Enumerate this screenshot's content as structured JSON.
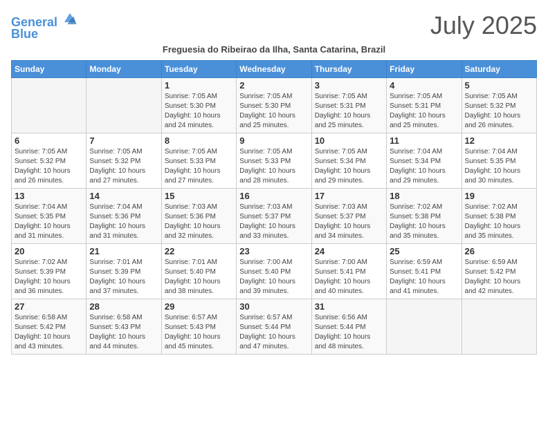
{
  "header": {
    "logo_line1": "General",
    "logo_line2": "Blue",
    "month_title": "July 2025",
    "subtitle": "Freguesia do Ribeirao da Ilha, Santa Catarina, Brazil"
  },
  "weekdays": [
    "Sunday",
    "Monday",
    "Tuesday",
    "Wednesday",
    "Thursday",
    "Friday",
    "Saturday"
  ],
  "weeks": [
    [
      {
        "day": "",
        "detail": ""
      },
      {
        "day": "",
        "detail": ""
      },
      {
        "day": "1",
        "detail": "Sunrise: 7:05 AM\nSunset: 5:30 PM\nDaylight: 10 hours and 24 minutes."
      },
      {
        "day": "2",
        "detail": "Sunrise: 7:05 AM\nSunset: 5:30 PM\nDaylight: 10 hours and 25 minutes."
      },
      {
        "day": "3",
        "detail": "Sunrise: 7:05 AM\nSunset: 5:31 PM\nDaylight: 10 hours and 25 minutes."
      },
      {
        "day": "4",
        "detail": "Sunrise: 7:05 AM\nSunset: 5:31 PM\nDaylight: 10 hours and 25 minutes."
      },
      {
        "day": "5",
        "detail": "Sunrise: 7:05 AM\nSunset: 5:32 PM\nDaylight: 10 hours and 26 minutes."
      }
    ],
    [
      {
        "day": "6",
        "detail": "Sunrise: 7:05 AM\nSunset: 5:32 PM\nDaylight: 10 hours and 26 minutes."
      },
      {
        "day": "7",
        "detail": "Sunrise: 7:05 AM\nSunset: 5:32 PM\nDaylight: 10 hours and 27 minutes."
      },
      {
        "day": "8",
        "detail": "Sunrise: 7:05 AM\nSunset: 5:33 PM\nDaylight: 10 hours and 27 minutes."
      },
      {
        "day": "9",
        "detail": "Sunrise: 7:05 AM\nSunset: 5:33 PM\nDaylight: 10 hours and 28 minutes."
      },
      {
        "day": "10",
        "detail": "Sunrise: 7:05 AM\nSunset: 5:34 PM\nDaylight: 10 hours and 29 minutes."
      },
      {
        "day": "11",
        "detail": "Sunrise: 7:04 AM\nSunset: 5:34 PM\nDaylight: 10 hours and 29 minutes."
      },
      {
        "day": "12",
        "detail": "Sunrise: 7:04 AM\nSunset: 5:35 PM\nDaylight: 10 hours and 30 minutes."
      }
    ],
    [
      {
        "day": "13",
        "detail": "Sunrise: 7:04 AM\nSunset: 5:35 PM\nDaylight: 10 hours and 31 minutes."
      },
      {
        "day": "14",
        "detail": "Sunrise: 7:04 AM\nSunset: 5:36 PM\nDaylight: 10 hours and 31 minutes."
      },
      {
        "day": "15",
        "detail": "Sunrise: 7:03 AM\nSunset: 5:36 PM\nDaylight: 10 hours and 32 minutes."
      },
      {
        "day": "16",
        "detail": "Sunrise: 7:03 AM\nSunset: 5:37 PM\nDaylight: 10 hours and 33 minutes."
      },
      {
        "day": "17",
        "detail": "Sunrise: 7:03 AM\nSunset: 5:37 PM\nDaylight: 10 hours and 34 minutes."
      },
      {
        "day": "18",
        "detail": "Sunrise: 7:02 AM\nSunset: 5:38 PM\nDaylight: 10 hours and 35 minutes."
      },
      {
        "day": "19",
        "detail": "Sunrise: 7:02 AM\nSunset: 5:38 PM\nDaylight: 10 hours and 35 minutes."
      }
    ],
    [
      {
        "day": "20",
        "detail": "Sunrise: 7:02 AM\nSunset: 5:39 PM\nDaylight: 10 hours and 36 minutes."
      },
      {
        "day": "21",
        "detail": "Sunrise: 7:01 AM\nSunset: 5:39 PM\nDaylight: 10 hours and 37 minutes."
      },
      {
        "day": "22",
        "detail": "Sunrise: 7:01 AM\nSunset: 5:40 PM\nDaylight: 10 hours and 38 minutes."
      },
      {
        "day": "23",
        "detail": "Sunrise: 7:00 AM\nSunset: 5:40 PM\nDaylight: 10 hours and 39 minutes."
      },
      {
        "day": "24",
        "detail": "Sunrise: 7:00 AM\nSunset: 5:41 PM\nDaylight: 10 hours and 40 minutes."
      },
      {
        "day": "25",
        "detail": "Sunrise: 6:59 AM\nSunset: 5:41 PM\nDaylight: 10 hours and 41 minutes."
      },
      {
        "day": "26",
        "detail": "Sunrise: 6:59 AM\nSunset: 5:42 PM\nDaylight: 10 hours and 42 minutes."
      }
    ],
    [
      {
        "day": "27",
        "detail": "Sunrise: 6:58 AM\nSunset: 5:42 PM\nDaylight: 10 hours and 43 minutes."
      },
      {
        "day": "28",
        "detail": "Sunrise: 6:58 AM\nSunset: 5:43 PM\nDaylight: 10 hours and 44 minutes."
      },
      {
        "day": "29",
        "detail": "Sunrise: 6:57 AM\nSunset: 5:43 PM\nDaylight: 10 hours and 45 minutes."
      },
      {
        "day": "30",
        "detail": "Sunrise: 6:57 AM\nSunset: 5:44 PM\nDaylight: 10 hours and 47 minutes."
      },
      {
        "day": "31",
        "detail": "Sunrise: 6:56 AM\nSunset: 5:44 PM\nDaylight: 10 hours and 48 minutes."
      },
      {
        "day": "",
        "detail": ""
      },
      {
        "day": "",
        "detail": ""
      }
    ]
  ]
}
